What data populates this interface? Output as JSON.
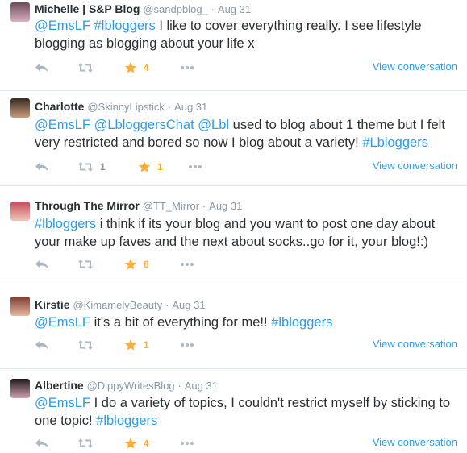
{
  "tweets": [
    {
      "name": "Michelle | S&P Blog",
      "handle": "@sandpblog_",
      "dot": "·",
      "time": "Aug 31",
      "segments": [
        {
          "text": "@EmsLF",
          "link": true
        },
        {
          "text": " ",
          "link": false
        },
        {
          "text": "#lbloggers",
          "link": true
        },
        {
          "text": " I like to cover everything really. I see lifestyle blogging as blogging about your life x",
          "link": false
        }
      ],
      "retweets": "",
      "favorites": "4",
      "view": "View conversation"
    },
    {
      "name": "Charlotte",
      "handle": "@SkinnyLipstick",
      "dot": "·",
      "time": "Aug 31",
      "segments": [
        {
          "text": "@EmsLF",
          "link": true
        },
        {
          "text": " ",
          "link": false
        },
        {
          "text": "@LbloggersChat",
          "link": true
        },
        {
          "text": " ",
          "link": false
        },
        {
          "text": "@Lbl",
          "link": true
        },
        {
          "text": " used to blog about 1 theme but I felt very restricted and bored so now I blog about a variety! ",
          "link": false
        },
        {
          "text": "#Lbloggers",
          "link": true
        }
      ],
      "retweets": "1",
      "favorites": "1",
      "view": "View conversation"
    },
    {
      "name": "Through The Mirror",
      "handle": "@TT_Mirror",
      "dot": "·",
      "time": "Aug 31",
      "segments": [
        {
          "text": "#lbloggers",
          "link": true
        },
        {
          "text": " i think if its your blog and you want to post one day about your make up faves and the next about socks..go for it, your blog!:)",
          "link": false
        }
      ],
      "retweets": "",
      "favorites": "8",
      "view": ""
    },
    {
      "name": "Kirstie",
      "handle": "@KimamelyBeauty",
      "dot": "·",
      "time": "Aug 31",
      "segments": [
        {
          "text": "@EmsLF",
          "link": true
        },
        {
          "text": " it's a bit of everything for me!! ",
          "link": false
        },
        {
          "text": "#lbloggers",
          "link": true
        }
      ],
      "retweets": "",
      "favorites": "1",
      "view": "View conversation"
    },
    {
      "name": "Albertine",
      "handle": "@DippyWritesBlog",
      "dot": "·",
      "time": "Aug 31",
      "segments": [
        {
          "text": "@EmsLF",
          "link": true
        },
        {
          "text": " I do a variety of topics, I couldn't restrict myself by sticking to one topic! ",
          "link": false
        },
        {
          "text": "#lbloggers",
          "link": true
        }
      ],
      "retweets": "",
      "favorites": "4",
      "view": "View conversation"
    }
  ],
  "icons": {
    "reply": "reply-icon",
    "retweet": "retweet-icon",
    "favorite": "star-icon",
    "more": "more-icon"
  },
  "colors": {
    "link": "#2b9de8",
    "star": "#ffac33",
    "muted": "#8899a6",
    "text": "#292f33"
  }
}
